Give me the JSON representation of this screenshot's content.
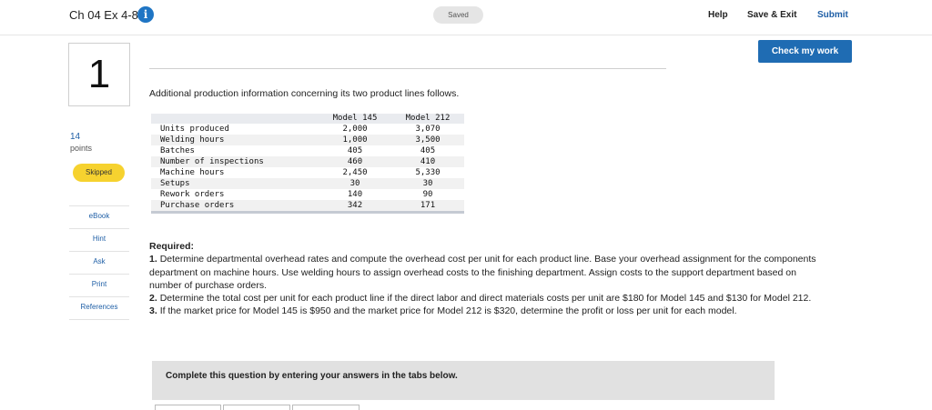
{
  "header": {
    "title": "Ch 04 Ex 4-8",
    "status": "Saved",
    "links": {
      "help": "Help",
      "save_exit": "Save & Exit",
      "submit": "Submit"
    },
    "check_button": "Check my work"
  },
  "question": {
    "number": "1",
    "points_value": "14",
    "points_label": "points",
    "status_badge": "Skipped"
  },
  "side_nav": [
    "eBook",
    "Hint",
    "Ask",
    "Print",
    "References"
  ],
  "intro": "Additional production information concerning its two product lines follows.",
  "table": {
    "columns": [
      "Model 145",
      "Model 212"
    ],
    "rows": [
      {
        "label": "Units produced",
        "m145": "2,000",
        "m212": "3,070"
      },
      {
        "label": "Welding hours",
        "m145": "1,000",
        "m212": "3,500"
      },
      {
        "label": "Batches",
        "m145": "405",
        "m212": "405"
      },
      {
        "label": "Number of inspections",
        "m145": "460",
        "m212": "410"
      },
      {
        "label": "Machine hours",
        "m145": "2,450",
        "m212": "5,330"
      },
      {
        "label": "Setups",
        "m145": "30",
        "m212": "30"
      },
      {
        "label": "Rework orders",
        "m145": "140",
        "m212": "90"
      },
      {
        "label": "Purchase orders",
        "m145": "342",
        "m212": "171"
      }
    ]
  },
  "required": {
    "heading": "Required:",
    "items": [
      {
        "num": "1.",
        "text": "Determine departmental overhead rates and compute the overhead cost per unit for each product line. Base your overhead assignment for the components department on machine hours. Use welding hours to assign overhead costs to the finishing department. Assign costs to the support department based on number of purchase orders."
      },
      {
        "num": "2.",
        "text": "Determine the total cost per unit for each product line if the direct labor and direct materials costs per unit are $180 for Model 145 and $130 for Model 212."
      },
      {
        "num": "3.",
        "text": "If the market price for Model 145 is $950 and the market price for Model 212 is $320, determine the profit or loss per unit for each model."
      }
    ]
  },
  "banner": "Complete this question by entering your answers in the tabs below."
}
